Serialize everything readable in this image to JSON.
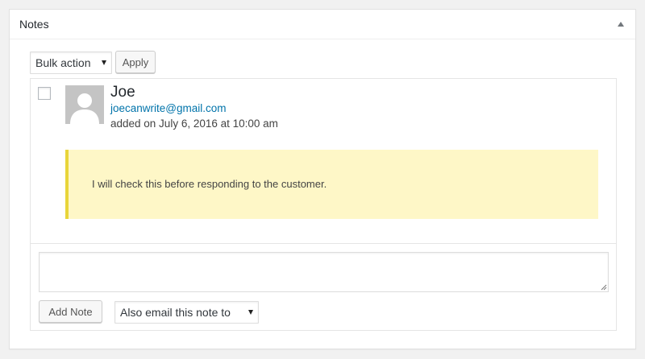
{
  "metabox": {
    "title": "Notes"
  },
  "toolbar": {
    "bulk_action": "Bulk action",
    "apply_label": "Apply"
  },
  "note": {
    "author": "Joe",
    "email": "joecanwrite@gmail.com",
    "date": "added on July 6, 2016 at 10:00 am",
    "content": "I will check this before responding to the customer."
  },
  "composer": {
    "textarea_value": "",
    "add_note_label": "Add Note",
    "email_option": "Also email this note to"
  },
  "colors": {
    "link": "#0073aa",
    "note_background": "#fef7c7",
    "note_border": "#e8d53a"
  }
}
